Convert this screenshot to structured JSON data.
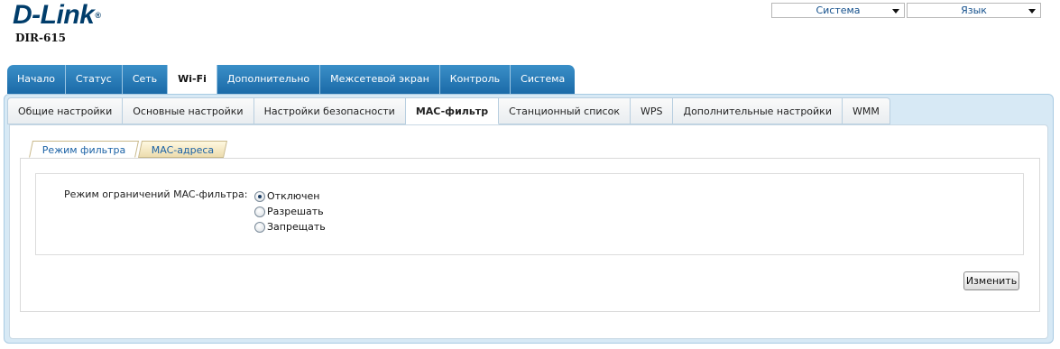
{
  "brand": {
    "logo": "D-Link",
    "reg_mark": "®",
    "model": "DIR-615"
  },
  "top_selects": {
    "system": "Система",
    "language": "Язык"
  },
  "main_tabs": [
    {
      "label": "Начало",
      "active": false
    },
    {
      "label": "Статус",
      "active": false
    },
    {
      "label": "Сеть",
      "active": false
    },
    {
      "label": "Wi-Fi",
      "active": true
    },
    {
      "label": "Дополнительно",
      "active": false
    },
    {
      "label": "Межсетевой экран",
      "active": false
    },
    {
      "label": "Контроль",
      "active": false
    },
    {
      "label": "Система",
      "active": false
    }
  ],
  "sub_tabs": [
    {
      "label": "Общие настройки",
      "active": false
    },
    {
      "label": "Основные настройки",
      "active": false
    },
    {
      "label": "Настройки безопасности",
      "active": false
    },
    {
      "label": "MAC-фильтр",
      "active": true
    },
    {
      "label": "Станционный список",
      "active": false
    },
    {
      "label": "WPS",
      "active": false
    },
    {
      "label": "Дополнительные настройки",
      "active": false
    },
    {
      "label": "WMM",
      "active": false
    }
  ],
  "inner_tabs": [
    {
      "label": "Режим фильтра",
      "active": true
    },
    {
      "label": "MAC-адреса",
      "active": false
    }
  ],
  "filter": {
    "label": "Режим ограничений MAC-фильтра:",
    "options": [
      {
        "label": "Отключен",
        "checked": true
      },
      {
        "label": "Разрешать",
        "checked": false
      },
      {
        "label": "Запрещать",
        "checked": false
      }
    ]
  },
  "actions": {
    "change_label": "Изменить"
  }
}
